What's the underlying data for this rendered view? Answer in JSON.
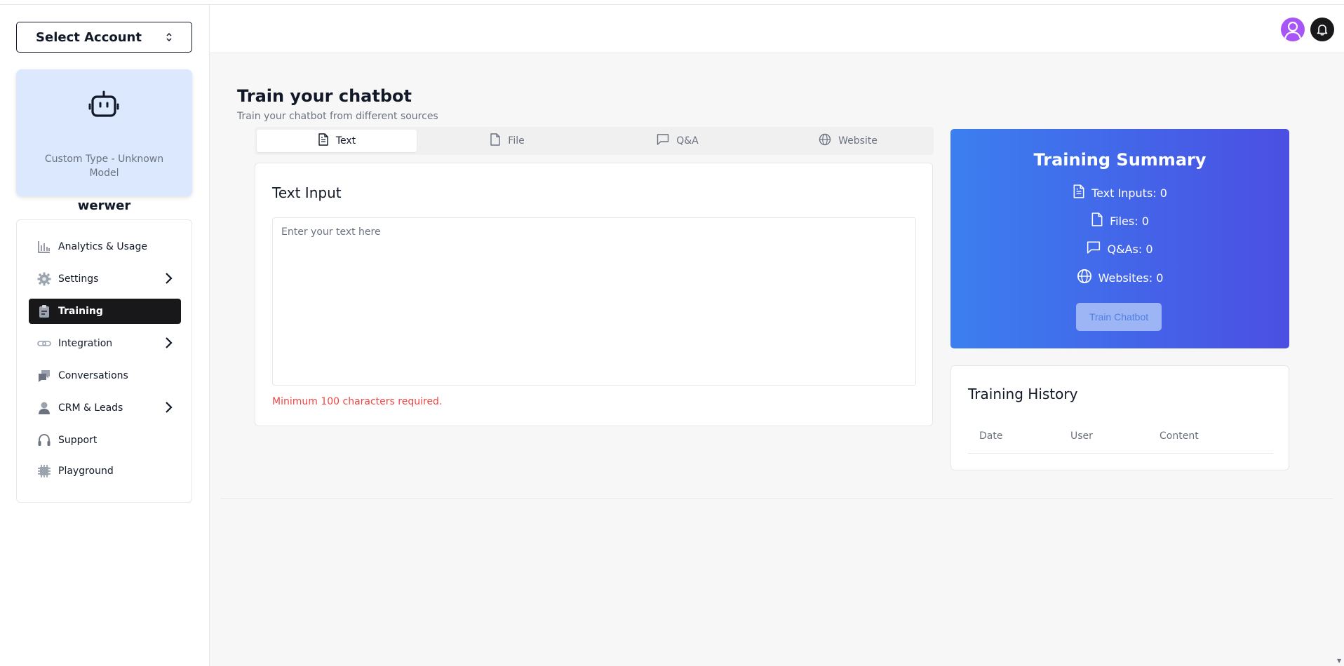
{
  "sidebar": {
    "account_select": {
      "label": "Select Account",
      "icon": "chevron-up-down-icon"
    },
    "bot": {
      "name": "werwer",
      "type": "Custom Type - Unknown Model",
      "icon": "robot-icon"
    },
    "nav": [
      {
        "label": "Analytics & Usage",
        "icon": "bar-chart-icon",
        "has_arrow": false,
        "active": false
      },
      {
        "label": "Settings",
        "icon": "gear-icon",
        "has_arrow": true,
        "active": false
      },
      {
        "label": "Training",
        "icon": "clipboard-icon",
        "has_arrow": false,
        "active": true
      },
      {
        "label": "Integration",
        "icon": "link-icon",
        "has_arrow": true,
        "active": false
      },
      {
        "label": "Conversations",
        "icon": "chat-bubbles-icon",
        "has_arrow": false,
        "active": false
      },
      {
        "label": "CRM & Leads",
        "icon": "user-icon",
        "has_arrow": true,
        "active": false
      },
      {
        "label": "Support",
        "icon": "headphones-icon",
        "has_arrow": false,
        "active": false
      },
      {
        "label": "Playground",
        "icon": "chip-icon",
        "has_arrow": false,
        "active": false
      }
    ]
  },
  "main": {
    "title": "Train your chatbot",
    "subtitle": "Train your chatbot from different sources",
    "tabs": [
      {
        "label": "Text",
        "icon": "document-text-icon",
        "active": true
      },
      {
        "label": "File",
        "icon": "file-icon",
        "active": false
      },
      {
        "label": "Q&A",
        "icon": "chat-icon",
        "active": false
      },
      {
        "label": "Website",
        "icon": "globe-icon",
        "active": false
      }
    ],
    "text_input": {
      "title": "Text Input",
      "value": "",
      "placeholder": "Enter your text here",
      "error": "Minimum 100 characters required."
    },
    "summary": {
      "title": "Training Summary",
      "lines": [
        {
          "label": "Text Inputs: 0",
          "icon": "document-text-icon"
        },
        {
          "label": "Files: 0",
          "icon": "file-icon"
        },
        {
          "label": "Q&As: 0",
          "icon": "chat-icon"
        },
        {
          "label": "Websites: 0",
          "icon": "globe-icon"
        }
      ],
      "button": "Train Chatbot"
    },
    "history": {
      "title": "Training History",
      "columns": [
        "Date",
        "User",
        "Content"
      ]
    }
  },
  "colors": {
    "accent_gradient_start": "#3b7ff0",
    "accent_gradient_end": "#4b4fe2",
    "active_nav": "#18181b",
    "error": "#ef4444",
    "avatar": "#a855f7",
    "bot_card": "#dbe8fd"
  }
}
